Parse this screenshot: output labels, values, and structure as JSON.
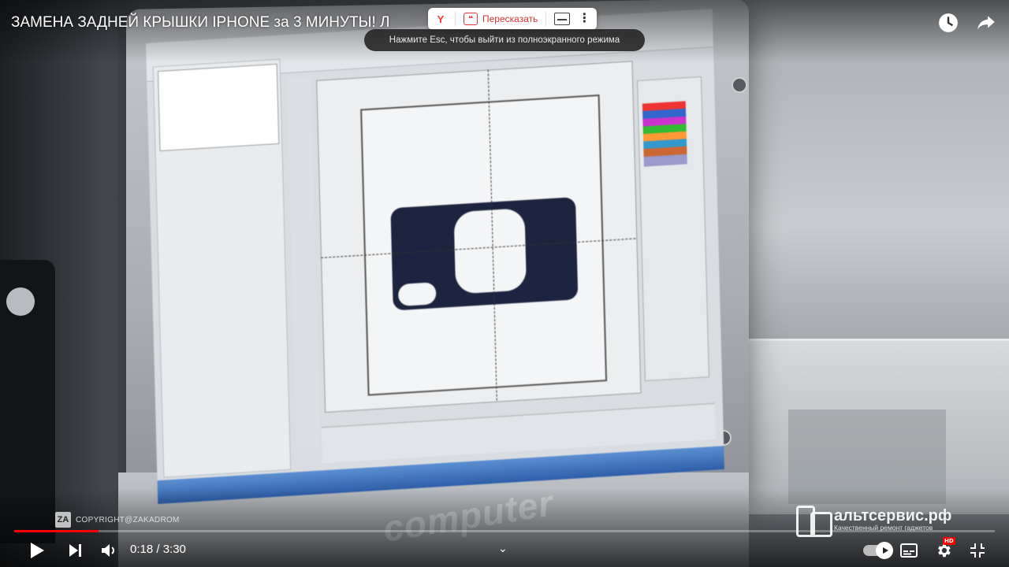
{
  "video": {
    "title": "ЗАМЕНА ЗАДНЕЙ КРЫШКИ IPHONE за 3 МИНУТЫ! Л",
    "monitor_brand_text": "computer"
  },
  "yandex_bar": {
    "logo": "Y",
    "retell_label": "Пересказать",
    "retell_icon": "quote-icon",
    "subtitles_icon": "subtitles-icon",
    "more_icon": "more-vert-icon"
  },
  "toast": {
    "text": "Нажмите Esc, чтобы выйти из полноэкранного режима"
  },
  "top_icons": [
    "watch-later-icon",
    "share-icon"
  ],
  "watermarks": {
    "left_badge": "ZA",
    "left_text": "COPYRIGHT@ZAKADROM",
    "right_title": "альтсервис.рф",
    "right_subtitle": "Качественный ремонт гаджетов"
  },
  "player": {
    "time_display": "0:18 / 3:30",
    "progress_fraction": 0.0857,
    "hd_badge": "HD",
    "accent_color": "#ff0000",
    "controls_left": [
      "play-icon",
      "next-icon",
      "volume-icon"
    ],
    "controls_right": [
      "autoplay-toggle",
      "subtitles-icon",
      "settings-icon",
      "exit-fullscreen-icon"
    ]
  }
}
